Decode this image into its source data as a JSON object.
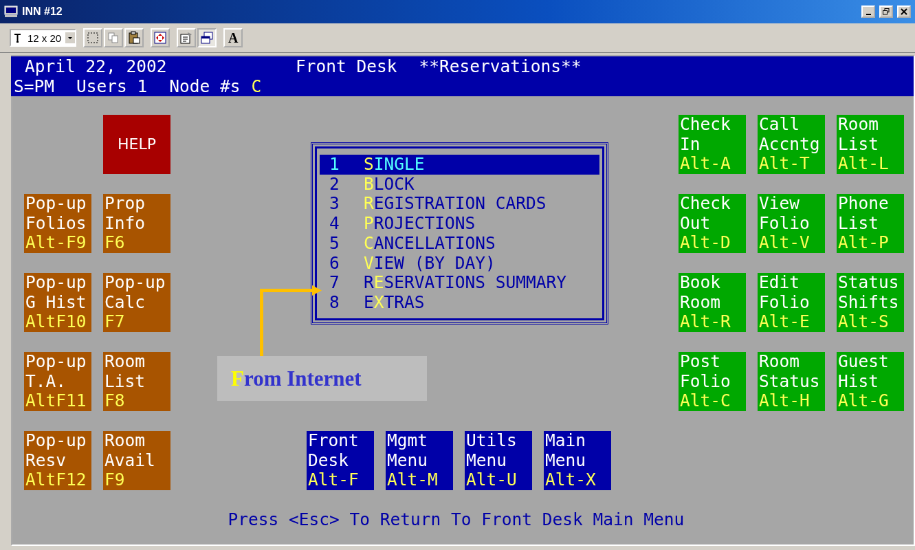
{
  "window": {
    "title": "INN #12"
  },
  "toolbar": {
    "font_size": "12 x 20",
    "font_button": "A"
  },
  "header": {
    "date": "April 22, 2002",
    "title": "Front Desk",
    "subtitle": "**Reservations**",
    "session": "S=PM",
    "users": "Users 1",
    "node_label": "Node #s",
    "node": "C"
  },
  "help_tile": {
    "label": "HELP"
  },
  "left_tiles": [
    {
      "lines": [
        "Pop-up",
        "Folios"
      ],
      "key": "Alt-F9"
    },
    {
      "lines": [
        "Prop",
        "Info"
      ],
      "key": "F6"
    },
    {
      "lines": [
        "Pop-up",
        "G Hist"
      ],
      "key": "AltF10"
    },
    {
      "lines": [
        "Pop-up",
        "Calc"
      ],
      "key": "F7"
    },
    {
      "lines": [
        "Pop-up",
        "T.A."
      ],
      "key": "AltF11"
    },
    {
      "lines": [
        "Room",
        "List"
      ],
      "key": "F8"
    },
    {
      "lines": [
        "Pop-up",
        "Resv"
      ],
      "key": "AltF12"
    },
    {
      "lines": [
        "Room",
        "Avail"
      ],
      "key": "F9"
    }
  ],
  "menu": [
    {
      "number": "1",
      "hotkey": "S",
      "after": "INGLE",
      "selected": true
    },
    {
      "number": "2",
      "hotkey": "B",
      "after": "LOCK",
      "selected": false
    },
    {
      "number": "3",
      "hotkey": "R",
      "after": "EGISTRATION CARDS",
      "selected": false
    },
    {
      "number": "4",
      "hotkey": "P",
      "after": "ROJECTIONS",
      "selected": false
    },
    {
      "number": "5",
      "hotkey": "C",
      "after": "ANCELLATIONS",
      "selected": false
    },
    {
      "number": "6",
      "hotkey": "V",
      "after": "IEW (BY DAY)",
      "selected": false
    },
    {
      "number": "7",
      "before": "R",
      "hotkey": "E",
      "after": "SERVATIONS SUMMARY",
      "selected": false
    },
    {
      "number": "8",
      "before": "E",
      "hotkey": "X",
      "after": "TRAS",
      "selected": false
    }
  ],
  "callout": {
    "initial": "F",
    "rest": "rom Internet"
  },
  "right_tiles": [
    {
      "lines": [
        "Check",
        "In"
      ],
      "key": "Alt-A"
    },
    {
      "lines": [
        "Call",
        "Accntg"
      ],
      "key": "Alt-T"
    },
    {
      "lines": [
        "Room",
        "List"
      ],
      "key": "Alt-L"
    },
    {
      "lines": [
        "Check",
        "Out"
      ],
      "key": "Alt-D"
    },
    {
      "lines": [
        "View",
        "Folio"
      ],
      "key": "Alt-V"
    },
    {
      "lines": [
        "Phone",
        "List"
      ],
      "key": "Alt-P"
    },
    {
      "lines": [
        "Book",
        "Room"
      ],
      "key": "Alt-R"
    },
    {
      "lines": [
        "Edit",
        "Folio"
      ],
      "key": "Alt-E"
    },
    {
      "lines": [
        "Status",
        "Shifts"
      ],
      "key": "Alt-S"
    },
    {
      "lines": [
        "Post",
        "Folio"
      ],
      "key": "Alt-C"
    },
    {
      "lines": [
        "Room",
        "Status"
      ],
      "key": "Alt-H"
    },
    {
      "lines": [
        "Guest",
        "Hist"
      ],
      "key": "Alt-G"
    }
  ],
  "bottom_tiles": [
    {
      "lines": [
        "Front",
        "Desk"
      ],
      "key": "Alt-F"
    },
    {
      "lines": [
        "Mgmt",
        "Menu"
      ],
      "key": "Alt-M"
    },
    {
      "lines": [
        "Utils",
        "Menu"
      ],
      "key": "Alt-U"
    },
    {
      "lines": [
        "Main",
        "Menu"
      ],
      "key": "Alt-X"
    }
  ],
  "footer": "Press <Esc> To Return To Front Desk Main Menu"
}
